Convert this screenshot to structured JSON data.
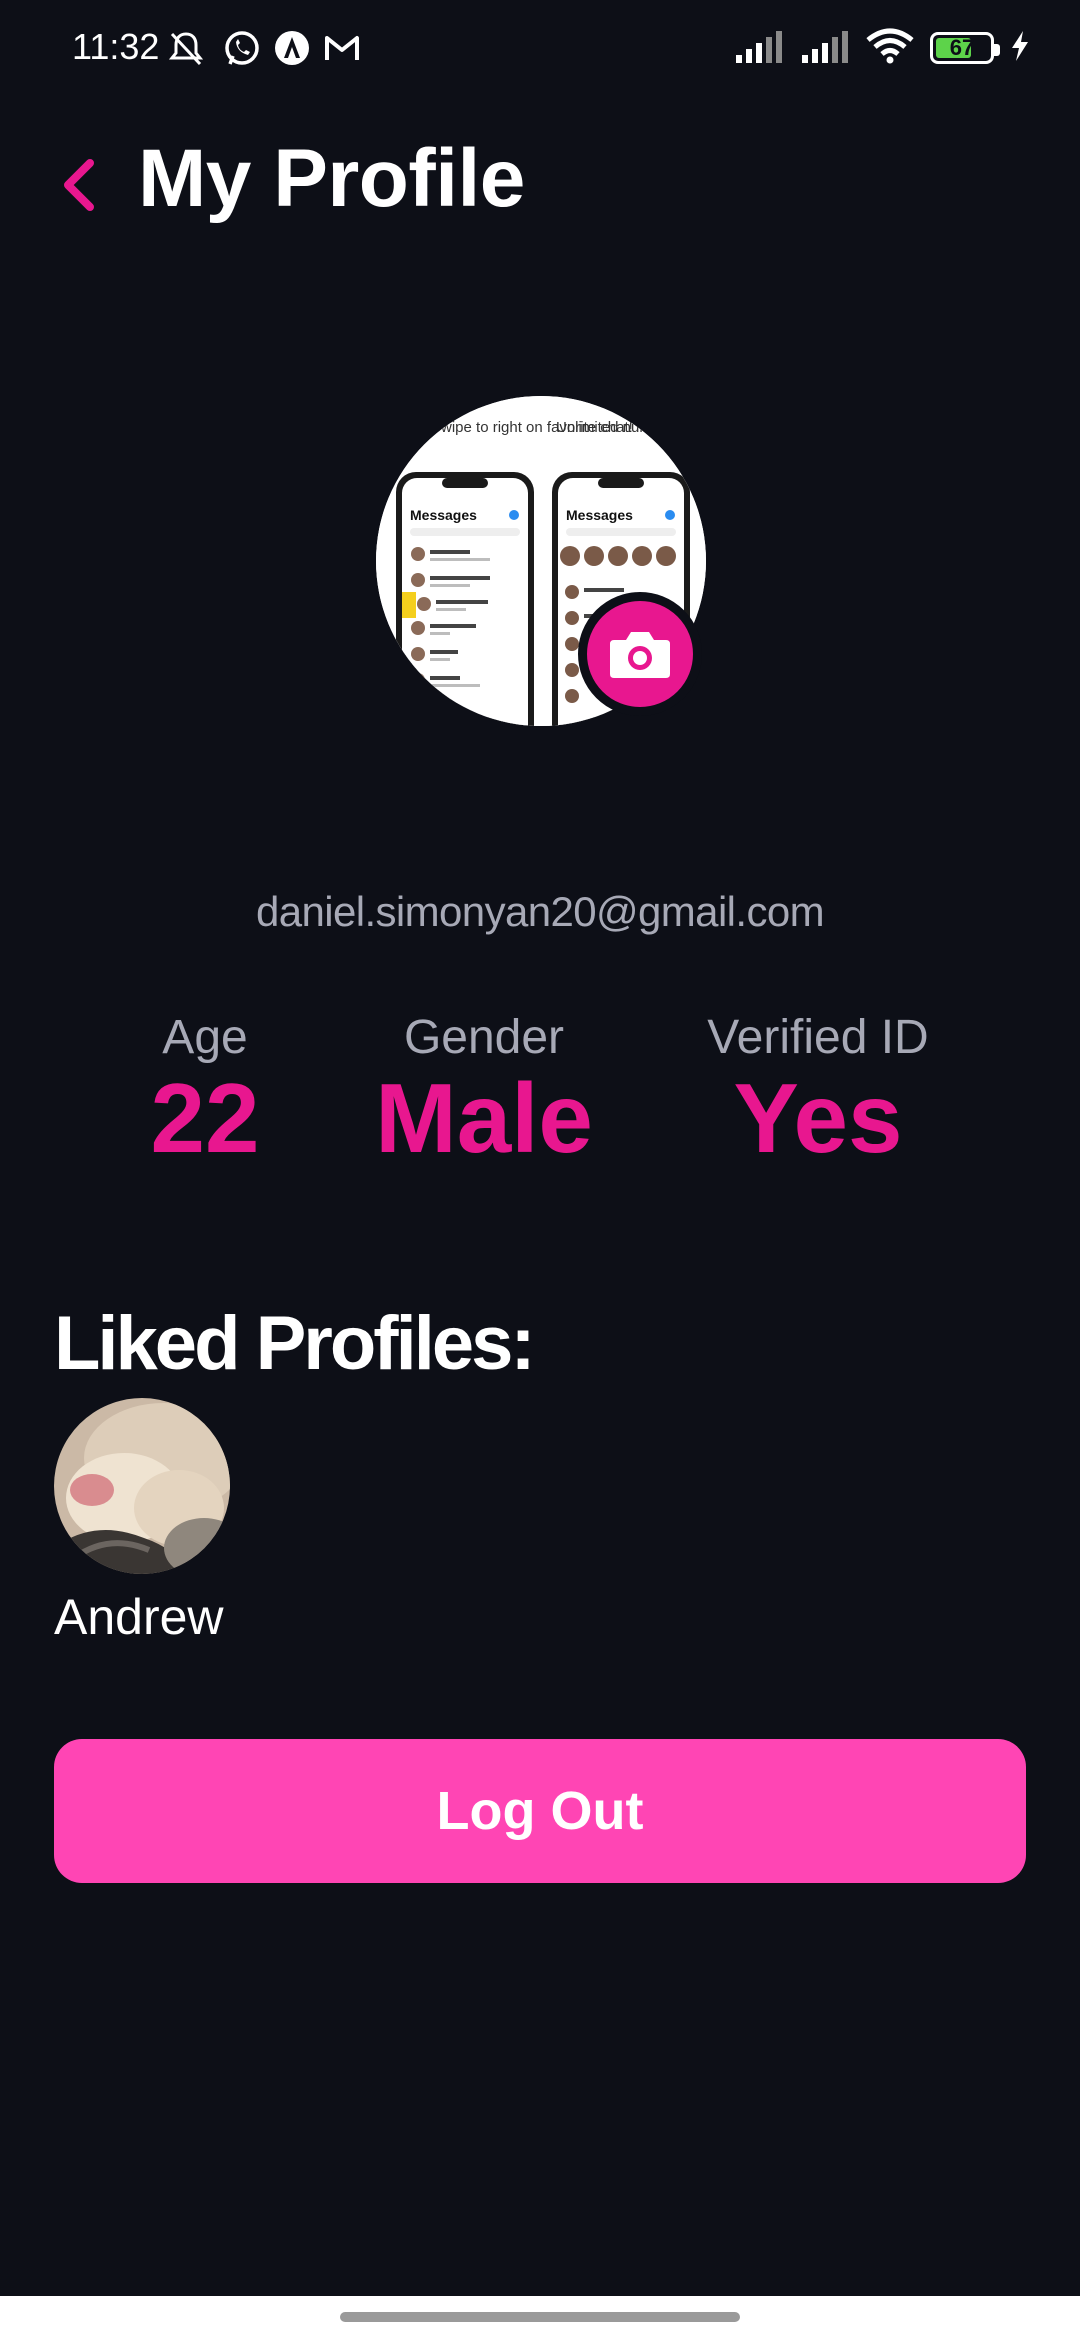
{
  "status_bar": {
    "time": "11:32",
    "battery_level": "67",
    "battery_fraction": 0.67,
    "left_icons": [
      "mute-icon",
      "whatsapp-icon",
      "arc-icon",
      "gmail-icon"
    ],
    "right_icons": [
      "signal-icon",
      "signal-icon",
      "wifi-icon",
      "battery-icon",
      "charging-icon"
    ]
  },
  "header": {
    "title": "My Profile",
    "back_icon": "chevron-left-icon"
  },
  "profile": {
    "photo_caption_left": "Swipe to right on favorite chat!",
    "photo_caption_right": "Unlimited number pins in scrollable",
    "photo_screen_title": "Messages",
    "camera_icon": "camera-icon",
    "email": "daniel.simonyan20@gmail.com"
  },
  "stats": [
    {
      "label": "Age",
      "value": "22"
    },
    {
      "label": "Gender",
      "value": "Male"
    },
    {
      "label": "Verified ID",
      "value": "Yes"
    }
  ],
  "liked_profiles": {
    "title": "Liked Profiles:",
    "items": [
      {
        "name": "Andrew"
      }
    ]
  },
  "actions": {
    "logout_label": "Log Out"
  },
  "colors": {
    "background": "#0d0f17",
    "accent": "#e8178f",
    "button": "#ff45b4",
    "muted_text": "#a7a9b6"
  }
}
